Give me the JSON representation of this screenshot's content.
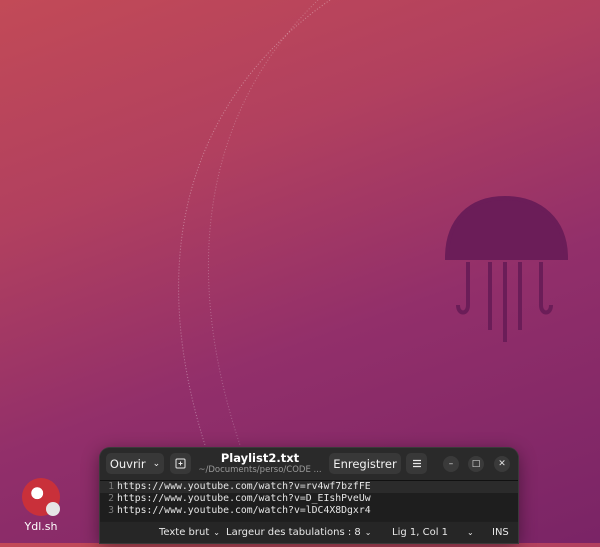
{
  "desktop": {
    "icons": [
      {
        "label": "Ydl.sh"
      }
    ]
  },
  "window": {
    "header": {
      "open_label": "Ouvrir",
      "title": "Playlist2.txt",
      "subtitle": "~/Documents/perso/CODE ...",
      "save_label": "Enregistrer"
    },
    "editor": {
      "lines": [
        {
          "number": "1",
          "text": "https://www.youtube.com/watch?v=rv4wf7bzfFE"
        },
        {
          "number": "2",
          "text": "https://www.youtube.com/watch?v=D_EIshPveUw"
        },
        {
          "number": "3",
          "text": "https://www.youtube.com/watch?v=lDC4X8Dgxr4"
        }
      ]
    },
    "statusbar": {
      "language": "Texte brut",
      "tab_width": "Largeur des tabulations : 8",
      "position": "Lig 1, Col 1",
      "mode": "INS"
    }
  },
  "colors": {
    "wallpaper_top": "#c24a57",
    "wallpaper_bottom": "#7a2466",
    "window_bg": "#1f1f1f"
  }
}
